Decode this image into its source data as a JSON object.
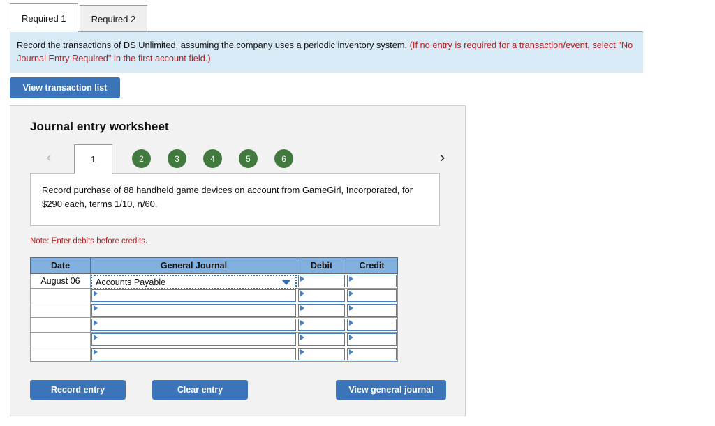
{
  "required_tabs": [
    {
      "label": "Required 1",
      "active": true
    },
    {
      "label": "Required 2",
      "active": false
    }
  ],
  "instructions": {
    "black_text": "Record the transactions of DS Unlimited, assuming the company uses a periodic inventory system.",
    "red_text": "(If no entry is required for a transaction/event, select \"No Journal Entry Required\" in the first account field.)"
  },
  "toolbar": {
    "view_transaction_list_label": "View transaction list"
  },
  "worksheet": {
    "title": "Journal entry worksheet",
    "pager": {
      "prev_icon": "chevron-left-icon",
      "next_icon": "chevron-right-icon",
      "active_page": "1",
      "pages": [
        "2",
        "3",
        "4",
        "5",
        "6"
      ],
      "active_color": "#ffffff",
      "circle_color": "#41793f"
    },
    "transaction_description": "Record purchase of 88 handheld game devices on account from GameGirl, Incorporated, for $290 each, terms 1/10, n/60.",
    "note": "Note: Enter debits before credits.",
    "table": {
      "headers": [
        "Date",
        "General Journal",
        "Debit",
        "Credit"
      ],
      "header_color": "#82b1e0",
      "rows": [
        {
          "date": "August 06",
          "account": "Accounts Payable",
          "debit": "",
          "credit": "",
          "focused": true
        },
        {
          "date": "",
          "account": "",
          "debit": "",
          "credit": "",
          "focused": false
        },
        {
          "date": "",
          "account": "",
          "debit": "",
          "credit": "",
          "focused": false
        },
        {
          "date": "",
          "account": "",
          "debit": "",
          "credit": "",
          "focused": false
        },
        {
          "date": "",
          "account": "",
          "debit": "",
          "credit": "",
          "focused": false
        },
        {
          "date": "",
          "account": "",
          "debit": "",
          "credit": "",
          "focused": false
        }
      ]
    },
    "buttons": {
      "record_entry": "Record entry",
      "clear_entry": "Clear entry",
      "view_general_journal": "View general journal",
      "color": "#3b74b8"
    }
  }
}
